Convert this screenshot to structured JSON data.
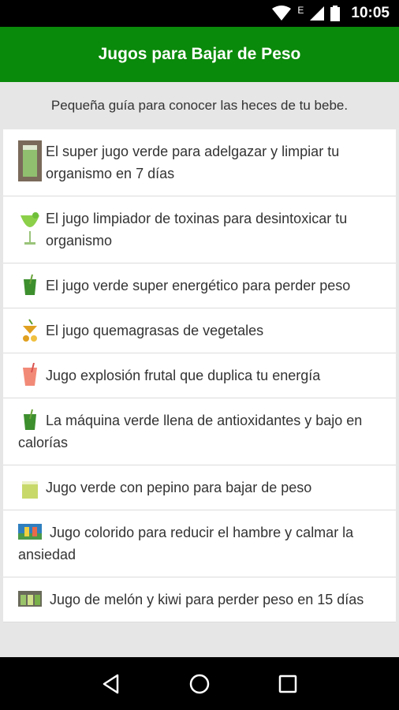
{
  "status": {
    "time": "10:05",
    "network_letter": "E"
  },
  "app_bar": {
    "title": "Jugos para Bajar de Peso"
  },
  "subtitle": "Pequeña guía para conocer las heces de tu bebe.",
  "items": [
    {
      "label": "El super jugo verde para adelgazar y limpiar tu organismo en 7 días",
      "icon": "green-juice-glass-icon"
    },
    {
      "label": "El jugo limpiador de toxinas para desintoxicar tu organismo",
      "icon": "green-cocktail-glass-icon"
    },
    {
      "label": "El jugo verde super energético para perder peso",
      "icon": "green-juice-cup-icon"
    },
    {
      "label": "El jugo quemagrasas de vegetales",
      "icon": "vegetable-juice-icon"
    },
    {
      "label": "Jugo explosión frutal que duplica tu energía",
      "icon": "fruit-smoothie-icon"
    },
    {
      "label": "La máquina verde llena de antioxidantes y bajo en calorías",
      "icon": "green-juice-cup-icon"
    },
    {
      "label": "Jugo verde con pepino para bajar de peso",
      "icon": "cucumber-juice-icon"
    },
    {
      "label": "Jugo colorido para reducir el hambre y calmar la ansiedad",
      "icon": "colorful-juice-icon"
    },
    {
      "label": "Jugo de melón y kiwi para perder peso en 15 días",
      "icon": "melon-kiwi-juice-icon"
    }
  ],
  "colors": {
    "app_bar": "#0a8a0a",
    "background": "#e6e6e6",
    "text": "#333333"
  }
}
